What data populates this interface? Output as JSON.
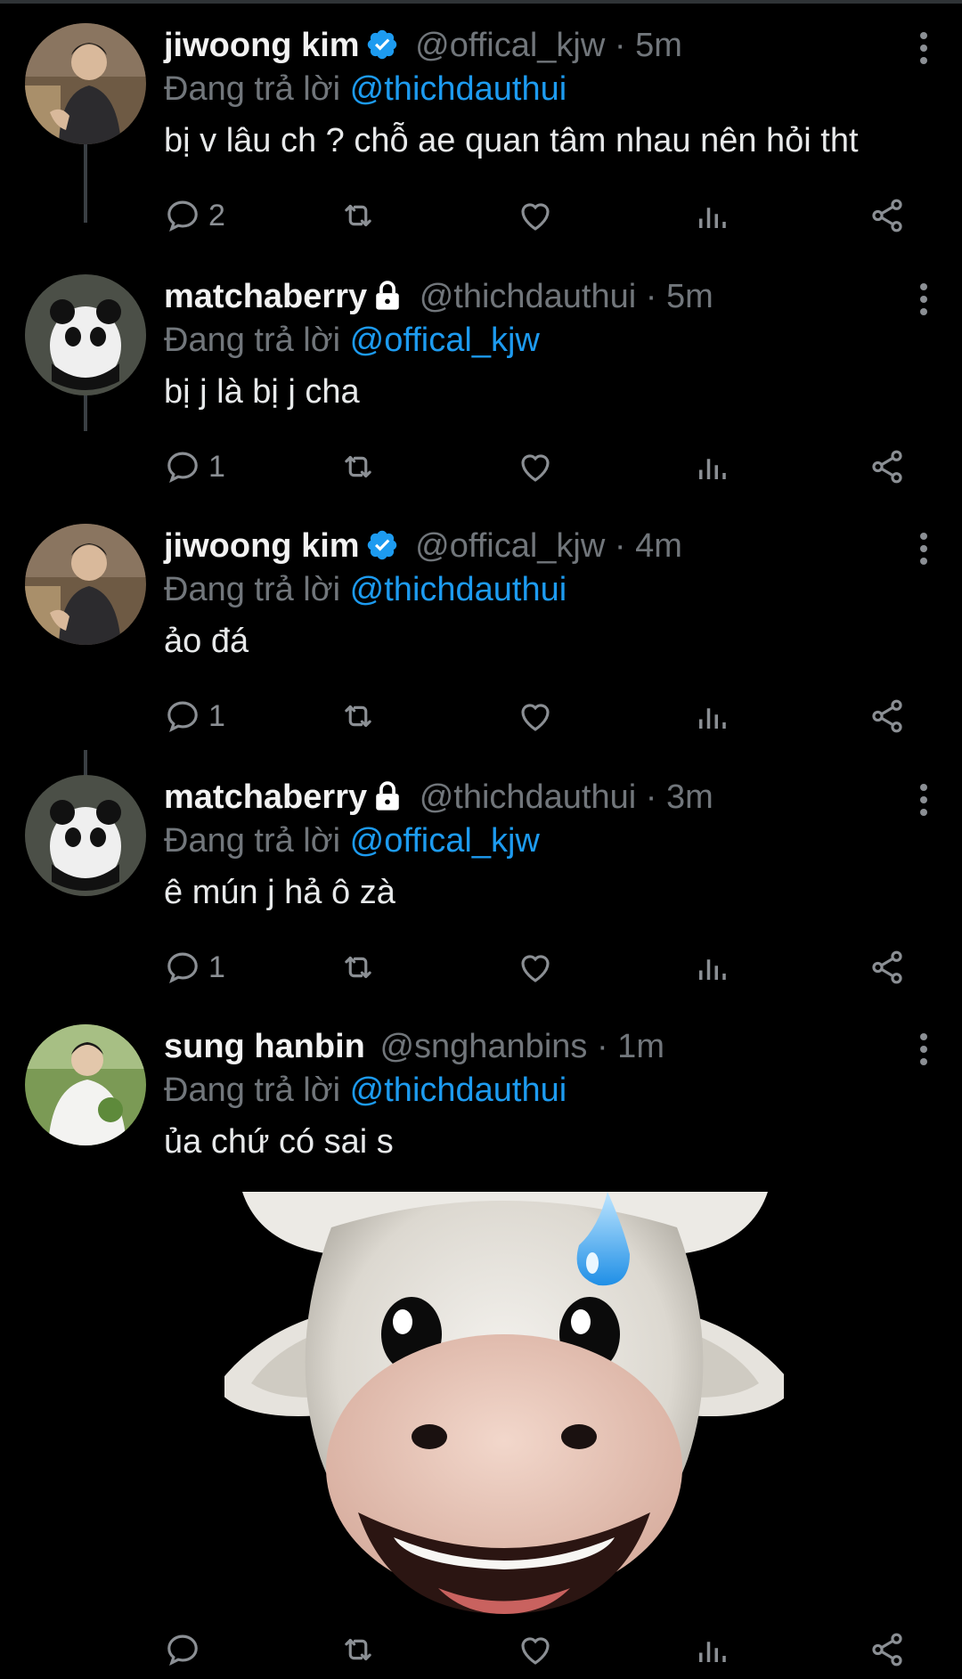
{
  "tweets": [
    {
      "name": "jiwoong kim",
      "badge": "verified",
      "handle": "@offical_kjw",
      "time": "· 5m",
      "reply_prefix": "Đang trả lời",
      "reply_to": "@thichdauthui",
      "text": "bị v lâu ch ? chỗ ae quan tâm nhau nên hỏi tht",
      "replies": "2",
      "avatar": "man-avatar"
    },
    {
      "name": "matchaberry",
      "badge": "locked",
      "handle": "@thichdauthui",
      "time": "· 5m",
      "reply_prefix": "Đang trả lời",
      "reply_to": "@offical_kjw",
      "text": "bị j là bị j cha",
      "replies": "1",
      "avatar": "panda-avatar"
    },
    {
      "name": "jiwoong kim",
      "badge": "verified",
      "handle": "@offical_kjw",
      "time": "· 4m",
      "reply_prefix": "Đang trả lời",
      "reply_to": "@thichdauthui",
      "text": "ảo đá",
      "replies": "1",
      "avatar": "man-avatar"
    },
    {
      "name": "matchaberry",
      "badge": "locked",
      "handle": "@thichdauthui",
      "time": "· 3m",
      "reply_prefix": "Đang trả lời",
      "reply_to": "@offical_kjw",
      "text": "ê mún j hả ô zà",
      "replies": "1",
      "avatar": "panda-avatar"
    },
    {
      "name": "sung hanbin",
      "badge": "none",
      "handle": "@snghanbins",
      "time": "· 1m",
      "reply_prefix": "Đang trả lời",
      "reply_to": "@thichdauthui",
      "text": "ủa chứ có sai s",
      "replies": "",
      "avatar": "man-white-shirt-avatar"
    }
  ],
  "media": {
    "description": "cow-memoji-sweat-drop"
  },
  "colors": {
    "background": "#000000",
    "text": "#e7e9ea",
    "muted": "#71767b",
    "link": "#1d9bf0",
    "thread_line": "#3a3f44"
  },
  "icons": [
    "reply-icon",
    "retweet-icon",
    "like-icon",
    "views-icon",
    "share-icon",
    "more-icon",
    "verified-icon",
    "lock-icon"
  ]
}
